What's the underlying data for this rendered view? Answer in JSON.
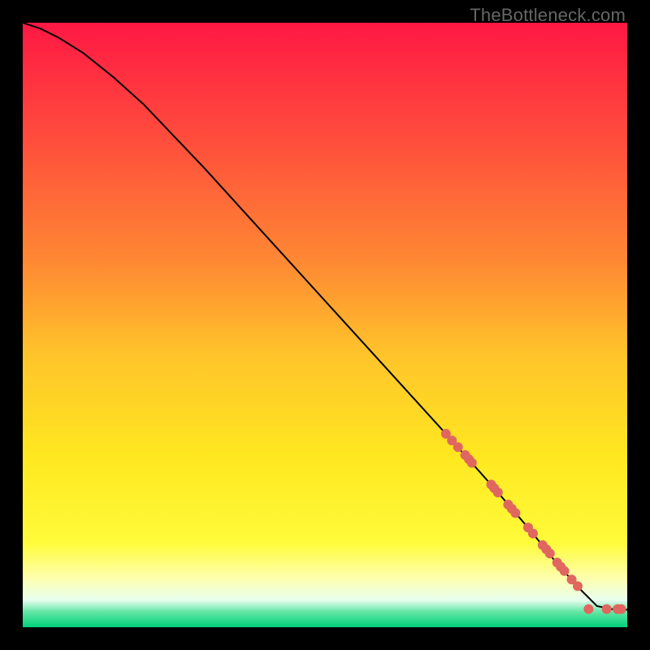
{
  "watermark": "TheBottleneck.com",
  "chart_data": {
    "type": "line",
    "title": "",
    "xlabel": "",
    "ylabel": "",
    "xlim": [
      0,
      100
    ],
    "ylim": [
      0,
      100
    ],
    "grid": false,
    "legend": false,
    "background_gradient": {
      "stops": [
        {
          "offset": 0.0,
          "color": "#ff1844"
        },
        {
          "offset": 0.2,
          "color": "#ff4f3c"
        },
        {
          "offset": 0.4,
          "color": "#ff8a33"
        },
        {
          "offset": 0.55,
          "color": "#ffc42a"
        },
        {
          "offset": 0.72,
          "color": "#ffe820"
        },
        {
          "offset": 0.86,
          "color": "#fffb3a"
        },
        {
          "offset": 0.92,
          "color": "#fdffb0"
        },
        {
          "offset": 0.955,
          "color": "#e8ffef"
        },
        {
          "offset": 0.975,
          "color": "#61e6a4"
        },
        {
          "offset": 1.0,
          "color": "#00d07a"
        }
      ]
    },
    "series": [
      {
        "name": "curve",
        "type": "line",
        "color": "#000000",
        "width": 2,
        "x": [
          0,
          3,
          6,
          10,
          15,
          20,
          30,
          40,
          50,
          60,
          70,
          78,
          84,
          88,
          92,
          95,
          98,
          100
        ],
        "y": [
          100,
          99,
          97.5,
          95,
          91,
          86.5,
          76,
          65,
          54,
          43,
          32,
          23,
          16,
          11,
          6.5,
          3.5,
          2.9,
          2.9
        ]
      },
      {
        "name": "points",
        "type": "scatter",
        "color": "#e0675f",
        "radius": 6,
        "x": [
          70.0,
          71.0,
          72.0,
          73.2,
          73.8,
          74.3,
          77.5,
          78.0,
          78.6,
          80.3,
          80.9,
          81.5,
          83.6,
          84.4,
          86.0,
          86.6,
          87.2,
          88.4,
          89.0,
          89.6,
          90.8,
          91.8,
          93.6,
          96.6,
          98.4,
          99.0
        ],
        "y": [
          32.0,
          30.9,
          29.8,
          28.5,
          27.8,
          27.2,
          23.6,
          23.0,
          22.3,
          20.3,
          19.6,
          18.9,
          16.5,
          15.5,
          13.6,
          12.9,
          12.2,
          10.7,
          10.0,
          9.3,
          7.9,
          6.8,
          3.0,
          3.0,
          3.0,
          3.0
        ]
      }
    ]
  }
}
